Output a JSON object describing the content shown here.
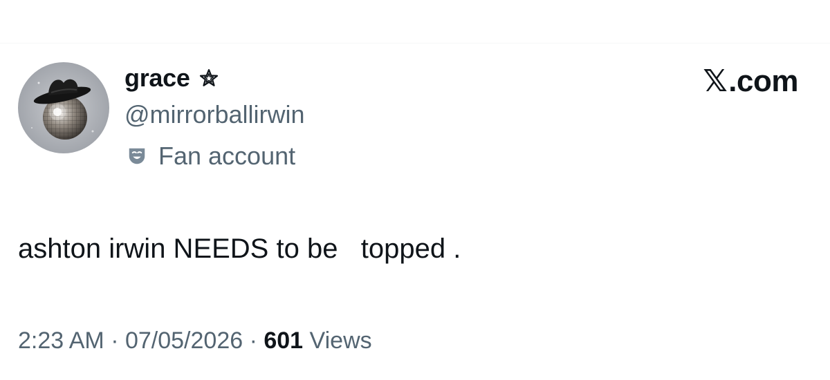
{
  "user": {
    "display_name": "grace",
    "badge_icon": "star-outline-icon",
    "handle": "@mirrorballirwin",
    "label_icon": "theater-mask-icon",
    "label": "Fan account"
  },
  "avatar": {
    "description_icon": "cowboy-hat-disco-ball-icon"
  },
  "site": {
    "logo_letter": "𝕏",
    "logo_suffix": ".com"
  },
  "tweet": {
    "text": "ashton irwin NEEDS to be   topped ."
  },
  "meta": {
    "time": "2:23 AM",
    "separator1": " · ",
    "date": "07/05/2026",
    "separator2": " · ",
    "views_count": "601",
    "views_label": " Views"
  },
  "colors": {
    "primary_text": "#0f1419",
    "secondary_text": "#536471",
    "background": "#ffffff"
  }
}
